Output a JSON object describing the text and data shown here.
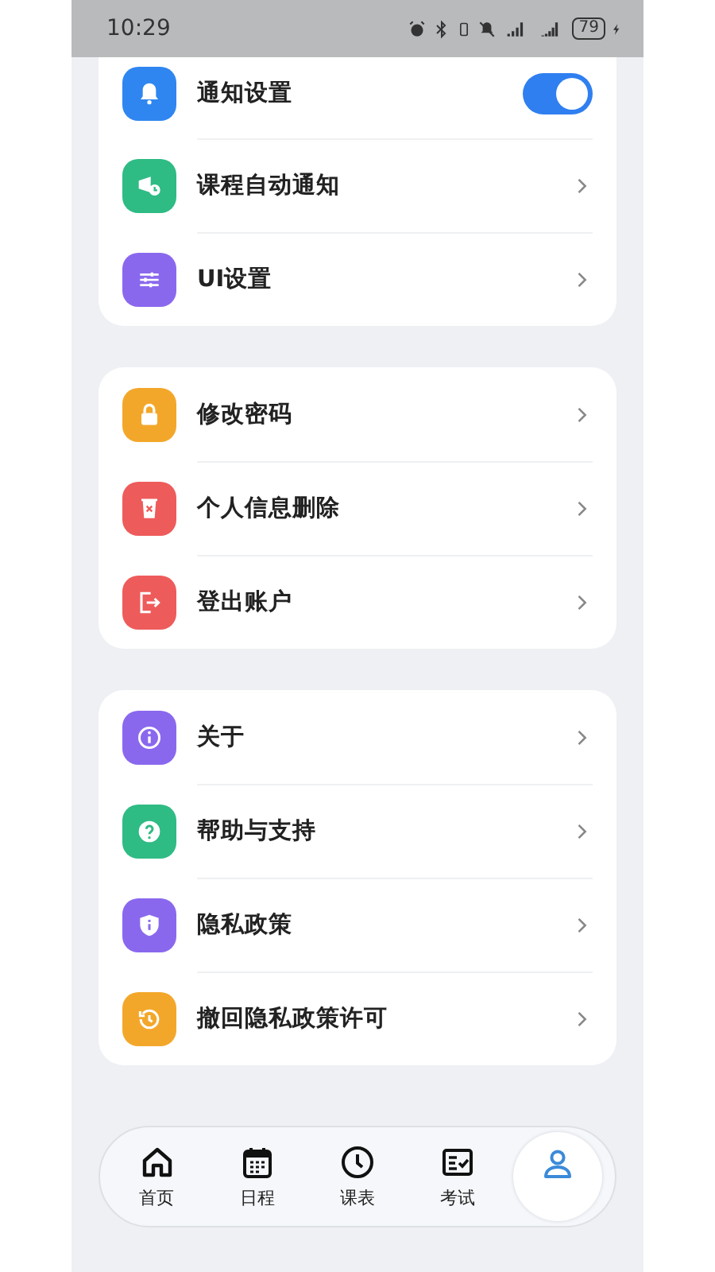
{
  "status_bar": {
    "time": "10:29",
    "battery": "79"
  },
  "sections": [
    {
      "items": [
        {
          "label": "通知设置",
          "kind": "toggle",
          "on": true,
          "color": "#2f86f0"
        },
        {
          "label": "课程自动通知",
          "kind": "link",
          "color": "#2fbb84"
        },
        {
          "label": "UI设置",
          "kind": "link",
          "color": "#8a68ee"
        }
      ]
    },
    {
      "items": [
        {
          "label": "修改密码",
          "kind": "link",
          "color": "#f3a72a"
        },
        {
          "label": "个人信息删除",
          "kind": "link",
          "color": "#ee5b5b"
        },
        {
          "label": "登出账户",
          "kind": "link",
          "color": "#ee5b5b"
        }
      ]
    },
    {
      "items": [
        {
          "label": "关于",
          "kind": "link",
          "color": "#8a68ee"
        },
        {
          "label": "帮助与支持",
          "kind": "link",
          "color": "#2fbb84"
        },
        {
          "label": "隐私政策",
          "kind": "link",
          "color": "#8a68ee"
        },
        {
          "label": "撤回隐私政策许可",
          "kind": "link",
          "color": "#f3a72a"
        }
      ]
    }
  ],
  "nav": [
    {
      "label": "首页",
      "selected": false
    },
    {
      "label": "日程",
      "selected": false
    },
    {
      "label": "课表",
      "selected": false
    },
    {
      "label": "考试",
      "selected": false
    },
    {
      "selected": true
    }
  ]
}
